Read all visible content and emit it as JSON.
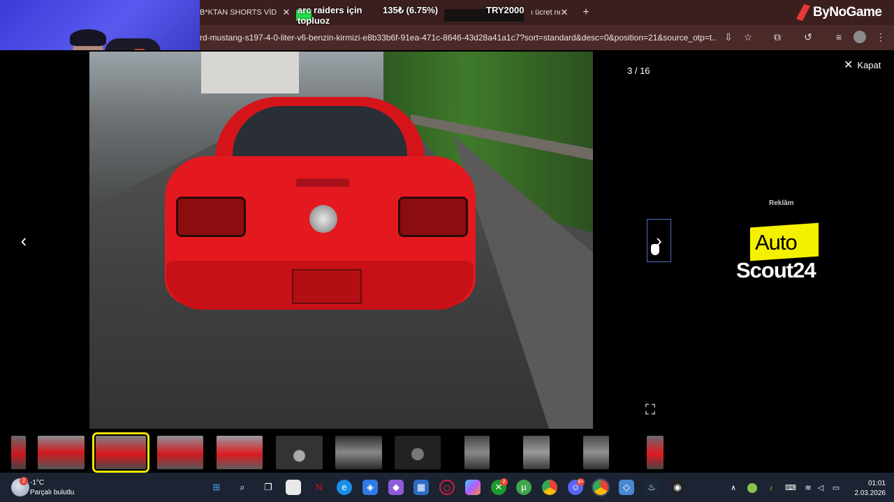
{
  "browser": {
    "tabs": [
      {
        "label": "B*KTAN SHORTS VİDEOLA"
      },
      {
        "label": "ı ücret ne"
      }
    ],
    "url": "rd-mustang-s197-4-0-liter-v6-benzin-kirmizi-e8b33b6f-91ea-471c-8646-43d28a41a1c7?sort=standard&desc=0&position=21&source_otp=t...",
    "new_tab_symbol": "+",
    "brand": "ByNoGame"
  },
  "stream_overlay": {
    "title": "arc raiders için topluoz",
    "stat": "135₺ (6.75%)",
    "tip": "TRY2000"
  },
  "viewer": {
    "counter": "3 / 16",
    "close_label": "Kapat",
    "prev_symbol": "‹",
    "next_symbol": "›",
    "shrink_symbol": "⛶"
  },
  "ad": {
    "label": "Reklâm",
    "brand_top": "Auto",
    "brand_bottom": "Scout24",
    "highlight_color": "#f5f000"
  },
  "thumbnails": [
    {
      "kind": "red-car"
    },
    {
      "kind": "red-car"
    },
    {
      "kind": "red-car",
      "active": true
    },
    {
      "kind": "red-car"
    },
    {
      "kind": "red-car"
    },
    {
      "kind": "interior"
    },
    {
      "kind": "interior"
    },
    {
      "kind": "interior"
    },
    {
      "kind": "seat"
    },
    {
      "kind": "seat"
    },
    {
      "kind": "seat"
    },
    {
      "kind": "red-car"
    }
  ],
  "taskbar": {
    "weather_temp": "-1°C",
    "weather_text": "Parçalı bulutlu",
    "weather_badge": "2",
    "xbox_badge": "2",
    "discord_badge": "9+",
    "time": "01:01",
    "date": "2.03.2026"
  },
  "colors": {
    "tabbar": "#3b1f1f",
    "accent_active": "#f2e600",
    "nav_focus": "#4a6fbf"
  }
}
